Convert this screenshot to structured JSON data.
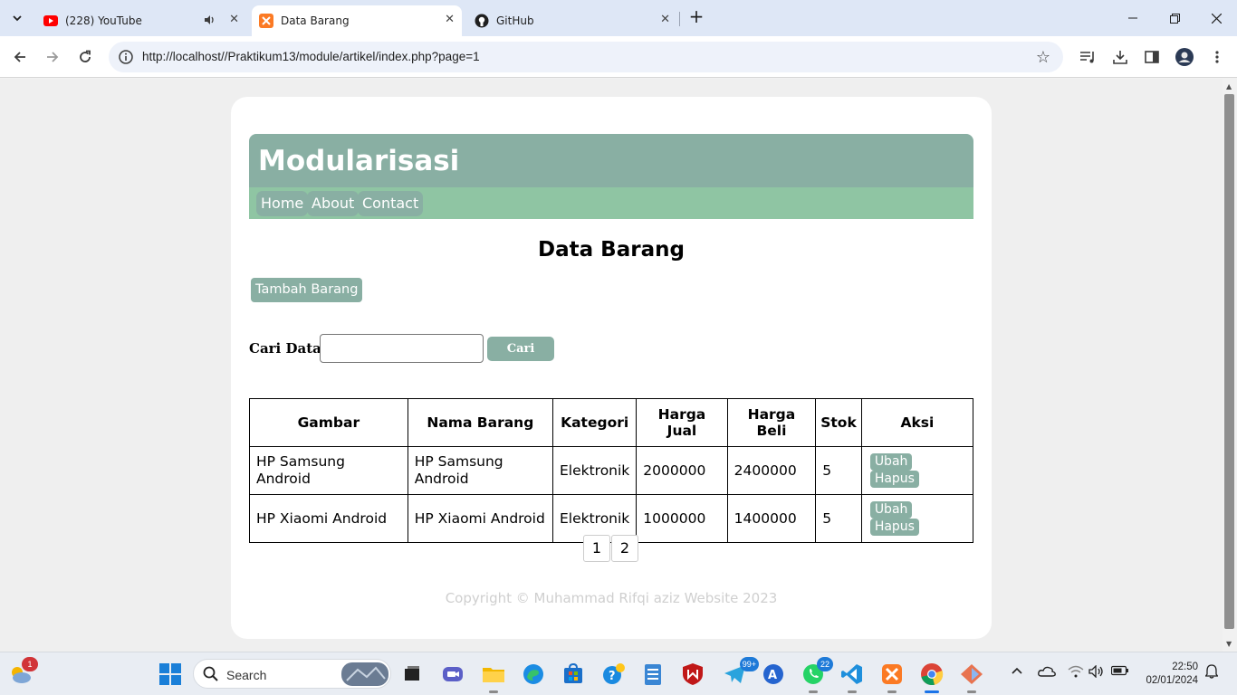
{
  "browser": {
    "tabs": [
      {
        "title": "(228) YouTube",
        "favicon": "youtube-icon",
        "audio": true
      },
      {
        "title": "Data Barang",
        "favicon": "xampp-icon",
        "active": true
      },
      {
        "title": "GitHub",
        "favicon": "github-icon"
      }
    ],
    "url": "http://localhost//Praktikum13/module/artikel/index.php?page=1"
  },
  "page": {
    "site_title": "Modularisasi",
    "nav": [
      "Home",
      "About",
      "Contact"
    ],
    "heading": "Data Barang",
    "add_button": "Tambah Barang",
    "search": {
      "label": "Cari Data:",
      "value": "",
      "button": "Cari"
    },
    "table": {
      "headers": [
        "Gambar",
        "Nama Barang",
        "Kategori",
        "Harga Jual",
        "Harga Beli",
        "Stok",
        "Aksi"
      ],
      "rows": [
        {
          "gambar_alt": "HP Samsung Android",
          "nama": "HP Samsung Android",
          "kategori": "Elektronik",
          "harga_jual": "2000000",
          "harga_beli": "2400000",
          "stok": "5",
          "ubah": "Ubah",
          "hapus": "Hapus"
        },
        {
          "gambar_alt": "HP Xiaomi Android",
          "nama": "HP Xiaomi Android",
          "kategori": "Elektronik",
          "harga_jual": "1000000",
          "harga_beli": "1400000",
          "stok": "5",
          "ubah": "Ubah",
          "hapus": "Hapus"
        }
      ]
    },
    "pagination": [
      "1",
      "2"
    ],
    "footer": "Copyright © Muhammad Rifqi aziz Website 2023"
  },
  "taskbar": {
    "search_placeholder": "Search",
    "weather_badge": "1",
    "telegram_badge": "99+",
    "whatsapp_badge": "22",
    "time": "22:50",
    "date": "02/01/2024"
  },
  "colors": {
    "header": "#89afa3",
    "nav": "#8fc5a3",
    "button": "#89afa3"
  }
}
